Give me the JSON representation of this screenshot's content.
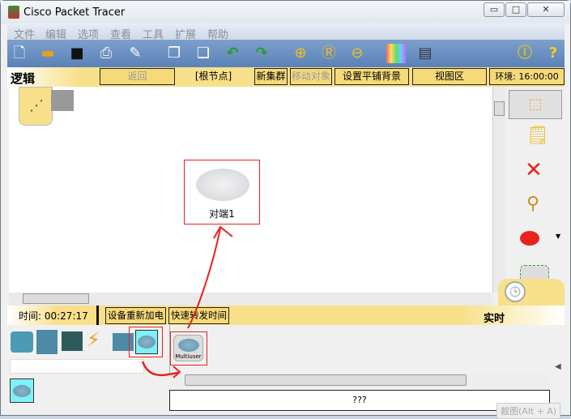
{
  "window": {
    "title": "Cisco Packet Tracer",
    "min": "▭",
    "max": "□",
    "close": "✕"
  },
  "menu": [
    "文件",
    "编辑",
    "选项",
    "查看",
    "工具",
    "扩展",
    "帮助"
  ],
  "logical_bar": {
    "label": "逻辑",
    "back": "返回",
    "root": "[根节点]",
    "new_cluster": "新集群",
    "move_object": "移动对象",
    "set_background": "设置平铺背景",
    "viewport": "视图区",
    "environment": "环境: 16:00:00"
  },
  "canvas": {
    "device_label": "对端1"
  },
  "realtime_bar": {
    "time": "时间: 00:27:17",
    "power_cycle": "设备重新加电",
    "fast_forward": "快速转发时间",
    "mode": "实时"
  },
  "device_panel": {
    "selected_device": "Multiuser",
    "status": "???",
    "screenshot_hint": "截图(Alt + A)"
  },
  "annotation_color": "#e8231c"
}
